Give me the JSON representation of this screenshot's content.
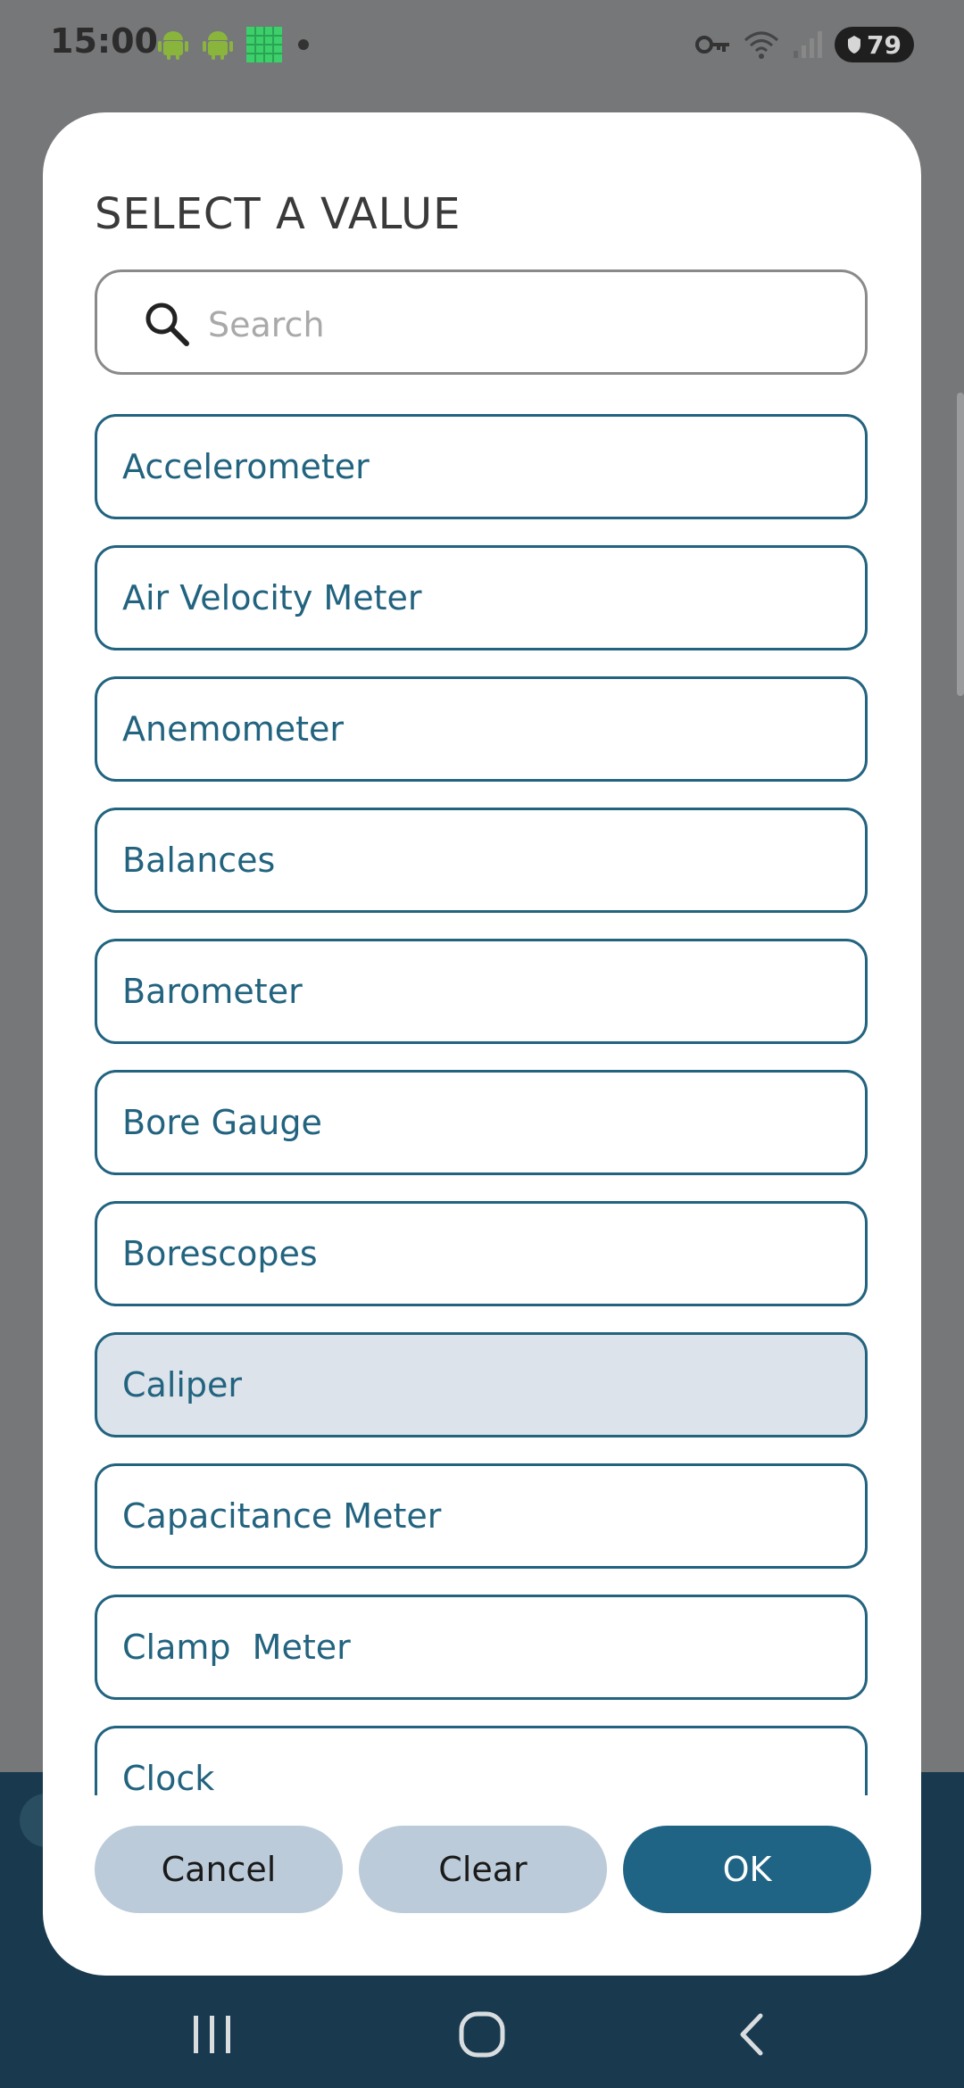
{
  "status_bar": {
    "time": "15:00",
    "battery": "79",
    "icons": [
      "android-icon",
      "android-icon",
      "grid-app-icon",
      "dot-icon",
      "vpn-key-icon",
      "wifi-icon",
      "signal-icon",
      "battery-icon"
    ]
  },
  "dialog": {
    "title": "SELECT A VALUE",
    "search_placeholder": "Search",
    "search_value": "",
    "items": [
      {
        "label": "Accelerometer",
        "selected": false
      },
      {
        "label": "Air Velocity Meter",
        "selected": false
      },
      {
        "label": "Anemometer",
        "selected": false
      },
      {
        "label": "Balances",
        "selected": false
      },
      {
        "label": "Barometer",
        "selected": false
      },
      {
        "label": "Bore Gauge",
        "selected": false
      },
      {
        "label": "Borescopes",
        "selected": false
      },
      {
        "label": "Caliper",
        "selected": true
      },
      {
        "label": "Capacitance Meter",
        "selected": false
      },
      {
        "label": "Clamp  Meter",
        "selected": false
      },
      {
        "label": "Clock",
        "selected": false
      }
    ],
    "buttons": {
      "cancel": "Cancel",
      "clear": "Clear",
      "ok": "OK"
    }
  },
  "colors": {
    "accent": "#22637f",
    "ok_button": "#1f6485",
    "secondary_button": "#bccbd9",
    "selected_item": "#dde3ea",
    "scrim": "#767779"
  }
}
